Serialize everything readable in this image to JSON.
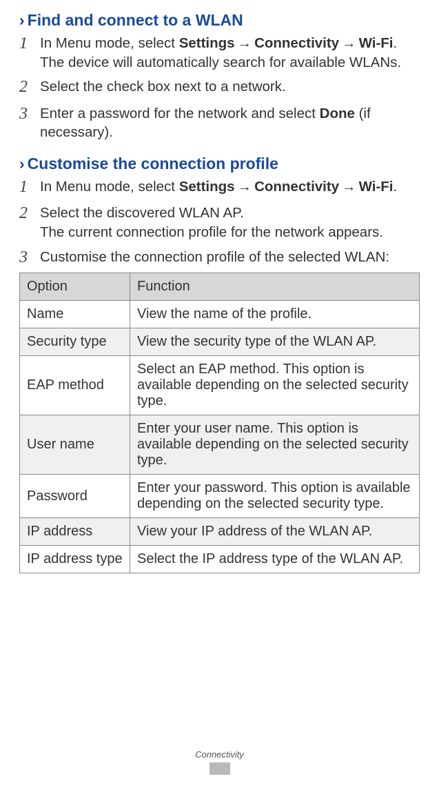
{
  "section1": {
    "heading": "Find and connect to a WLAN",
    "steps": [
      {
        "num": "1",
        "prefix": "In Menu mode, select ",
        "path": [
          "Settings",
          "Connectivity",
          "Wi-Fi"
        ],
        "suffix": ". The device will automatically search for available WLANs."
      },
      {
        "num": "2",
        "text": "Select the check box next to a network."
      },
      {
        "num": "3",
        "prefix": "Enter a password for the network and select ",
        "bold": "Done",
        "suffix": " (if necessary)."
      }
    ]
  },
  "section2": {
    "heading": "Customise the connection profile",
    "steps": [
      {
        "num": "1",
        "prefix": "In Menu mode, select ",
        "path": [
          "Settings",
          "Connectivity",
          "Wi-Fi"
        ],
        "suffix": "."
      },
      {
        "num": "2",
        "line1": "Select the discovered WLAN AP.",
        "line2": "The current connection profile for the network appears."
      },
      {
        "num": "3",
        "text": "Customise the connection profile of the selected WLAN:"
      }
    ]
  },
  "table": {
    "headers": {
      "option": "Option",
      "function": "Function"
    },
    "rows": [
      {
        "option": "Name",
        "function": "View the name of the profile."
      },
      {
        "option": "Security type",
        "function": "View the security type of the WLAN AP."
      },
      {
        "option": "EAP method",
        "function": "Select an EAP method. This option is available depending on the selected security type."
      },
      {
        "option": "User name",
        "function": "Enter your user name. This option is available depending on the selected security type."
      },
      {
        "option": "Password",
        "function": "Enter your password. This option is available depending on the selected security type."
      },
      {
        "option": "IP address",
        "function": "View your IP address of the WLAN AP."
      },
      {
        "option": "IP address type",
        "function": "Select the IP address type of the WLAN AP."
      }
    ]
  },
  "footer": {
    "label": "Connectivity"
  },
  "arrow": "→",
  "chevron": "›"
}
